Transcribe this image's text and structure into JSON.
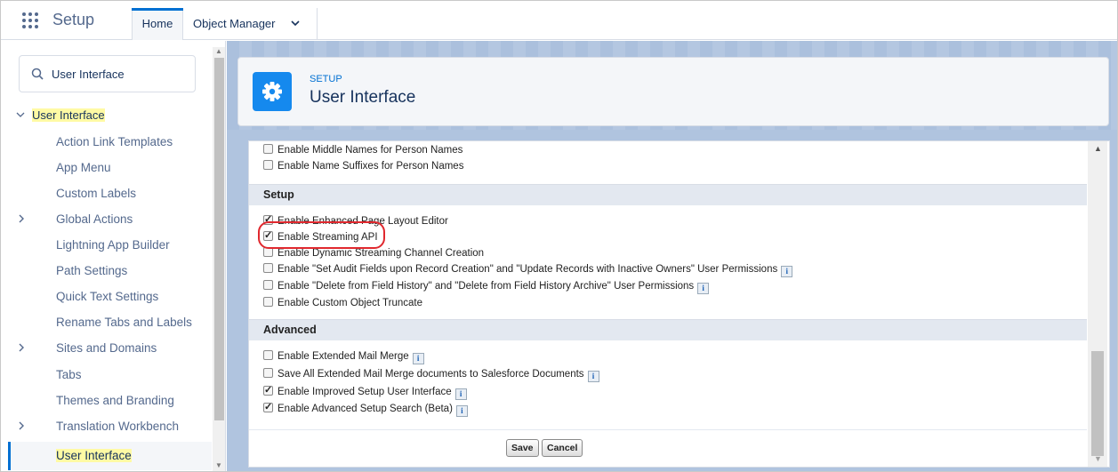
{
  "topbar": {
    "app_title": "Setup",
    "tab_home": "Home",
    "tab_object_manager": "Object Manager"
  },
  "sidebar": {
    "search_value": "User Interface",
    "root_label": "User Interface",
    "items": [
      {
        "label": "Action Link Templates",
        "expandable": false
      },
      {
        "label": "App Menu",
        "expandable": false
      },
      {
        "label": "Custom Labels",
        "expandable": false
      },
      {
        "label": "Global Actions",
        "expandable": true
      },
      {
        "label": "Lightning App Builder",
        "expandable": false
      },
      {
        "label": "Path Settings",
        "expandable": false
      },
      {
        "label": "Quick Text Settings",
        "expandable": false
      },
      {
        "label": "Rename Tabs and Labels",
        "expandable": false
      },
      {
        "label": "Sites and Domains",
        "expandable": true
      },
      {
        "label": "Tabs",
        "expandable": false
      },
      {
        "label": "Themes and Branding",
        "expandable": false
      },
      {
        "label": "Translation Workbench",
        "expandable": true
      }
    ],
    "selected_label": "User Interface"
  },
  "header": {
    "eyebrow": "SETUP",
    "title": "User Interface"
  },
  "content": {
    "top_rows": [
      {
        "label": "Enable Middle Names for Person Names",
        "checked": false
      },
      {
        "label": "Enable Name Suffixes for Person Names",
        "checked": false
      }
    ],
    "setup_section": {
      "title": "Setup",
      "rows": [
        {
          "label": "Enable Enhanced Page Layout Editor",
          "checked": true,
          "info": false
        },
        {
          "label": "Enable Streaming API",
          "checked": true,
          "info": false
        },
        {
          "label": "Enable Dynamic Streaming Channel Creation",
          "checked": false,
          "info": false
        },
        {
          "label": "Enable \"Set Audit Fields upon Record Creation\" and \"Update Records with Inactive Owners\" User Permissions",
          "checked": false,
          "info": true
        },
        {
          "label": "Enable \"Delete from Field History\" and \"Delete from Field History Archive\" User Permissions",
          "checked": false,
          "info": true
        },
        {
          "label": "Enable Custom Object Truncate",
          "checked": false,
          "info": false
        }
      ]
    },
    "advanced_section": {
      "title": "Advanced",
      "rows": [
        {
          "label": "Enable Extended Mail Merge",
          "checked": false,
          "info": true
        },
        {
          "label": "Save All Extended Mail Merge documents to Salesforce Documents",
          "checked": false,
          "info": true
        },
        {
          "label": "Enable Improved Setup User Interface",
          "checked": true,
          "info": true
        },
        {
          "label": "Enable Advanced Setup Search (Beta)",
          "checked": true,
          "info": true
        }
      ]
    },
    "save_label": "Save",
    "cancel_label": "Cancel",
    "info_glyph": "i"
  },
  "colors": {
    "accent": "#0070d2",
    "highlight": "#fffaa4",
    "annotation_oval": "#e0282e"
  }
}
